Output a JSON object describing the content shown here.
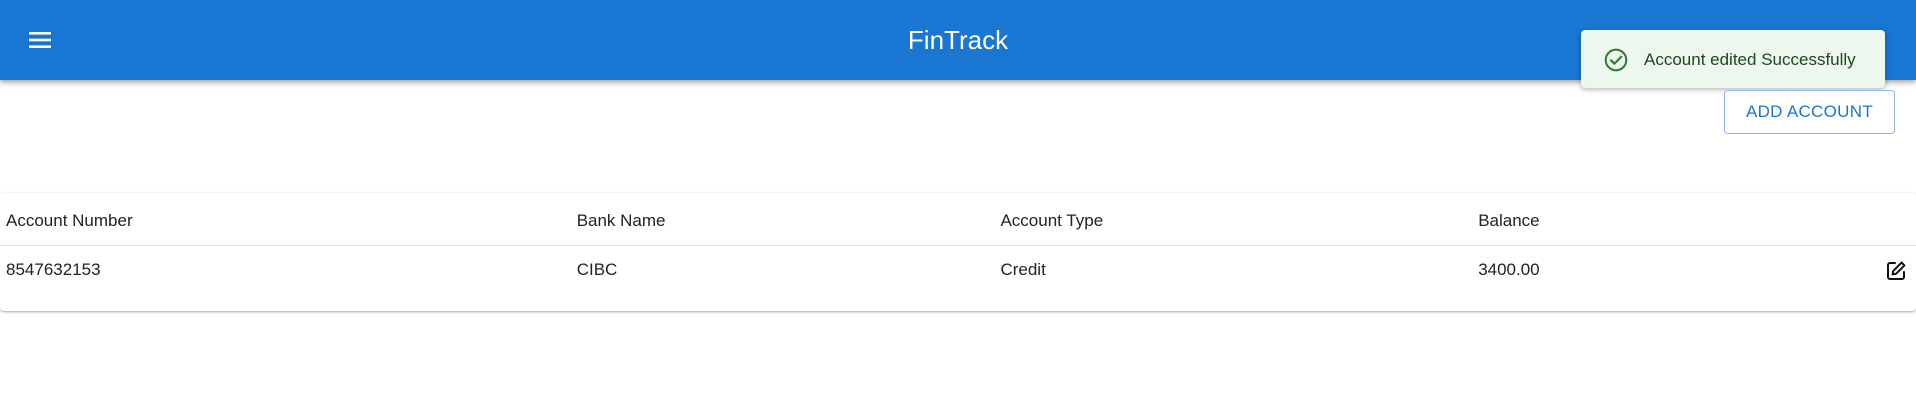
{
  "appbar": {
    "title": "FinTrack",
    "menu_icon": "menu-icon",
    "color": "#1976d2"
  },
  "toast": {
    "message": "Account edited Successfully",
    "icon": "check-circle-icon",
    "severity": "success",
    "background": "#edf7ed",
    "icon_color": "#2e7d32"
  },
  "actions": {
    "add_account_label": "ADD ACCOUNT"
  },
  "table": {
    "headers": [
      "Account Number",
      "Bank Name",
      "Account Type",
      "Balance"
    ],
    "rows": [
      {
        "account_number": "8547632153",
        "bank_name": "CIBC",
        "account_type": "Credit",
        "balance": "3400.00",
        "action_icon": "edit-icon"
      }
    ]
  }
}
